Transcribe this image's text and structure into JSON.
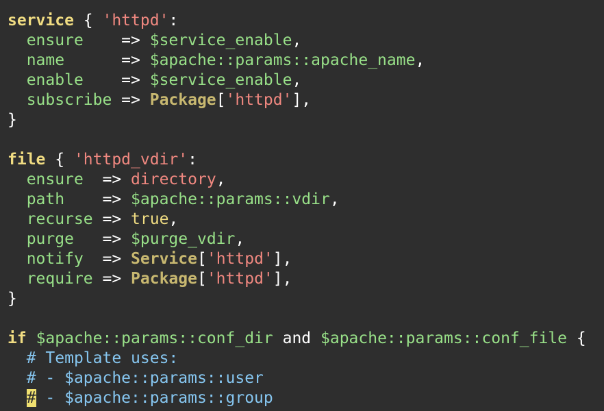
{
  "editor": {
    "lines": [
      [
        {
          "t": "service",
          "c": "kw"
        },
        {
          "t": " { ",
          "c": "op"
        },
        {
          "t": "'httpd'",
          "c": "str"
        },
        {
          "t": ":",
          "c": "op"
        }
      ],
      [
        {
          "t": "  ",
          "c": "op"
        },
        {
          "t": "ensure",
          "c": "attr"
        },
        {
          "t": "    => ",
          "c": "op"
        },
        {
          "t": "$service_enable",
          "c": "var"
        },
        {
          "t": ",",
          "c": "op"
        }
      ],
      [
        {
          "t": "  ",
          "c": "op"
        },
        {
          "t": "name",
          "c": "attr"
        },
        {
          "t": "      => ",
          "c": "op"
        },
        {
          "t": "$apache::params::apache_name",
          "c": "var"
        },
        {
          "t": ",",
          "c": "op"
        }
      ],
      [
        {
          "t": "  ",
          "c": "op"
        },
        {
          "t": "enable",
          "c": "attr"
        },
        {
          "t": "    => ",
          "c": "op"
        },
        {
          "t": "$service_enable",
          "c": "var"
        },
        {
          "t": ",",
          "c": "op"
        }
      ],
      [
        {
          "t": "  ",
          "c": "op"
        },
        {
          "t": "subscribe",
          "c": "attr"
        },
        {
          "t": " => ",
          "c": "op"
        },
        {
          "t": "Package",
          "c": "type"
        },
        {
          "t": "[",
          "c": "op"
        },
        {
          "t": "'httpd'",
          "c": "str"
        },
        {
          "t": "],",
          "c": "op"
        }
      ],
      [
        {
          "t": "}",
          "c": "op"
        }
      ],
      [],
      [
        {
          "t": "file",
          "c": "kw"
        },
        {
          "t": " { ",
          "c": "op"
        },
        {
          "t": "'httpd_vdir'",
          "c": "str"
        },
        {
          "t": ":",
          "c": "op"
        }
      ],
      [
        {
          "t": "  ",
          "c": "op"
        },
        {
          "t": "ensure",
          "c": "attr"
        },
        {
          "t": "  => ",
          "c": "op"
        },
        {
          "t": "directory",
          "c": "const"
        },
        {
          "t": ",",
          "c": "op"
        }
      ],
      [
        {
          "t": "  ",
          "c": "op"
        },
        {
          "t": "path",
          "c": "attr"
        },
        {
          "t": "    => ",
          "c": "op"
        },
        {
          "t": "$apache::params::vdir",
          "c": "var"
        },
        {
          "t": ",",
          "c": "op"
        }
      ],
      [
        {
          "t": "  ",
          "c": "op"
        },
        {
          "t": "recurse",
          "c": "attr"
        },
        {
          "t": " => ",
          "c": "op"
        },
        {
          "t": "true",
          "c": "bool"
        },
        {
          "t": ",",
          "c": "op"
        }
      ],
      [
        {
          "t": "  ",
          "c": "op"
        },
        {
          "t": "purge",
          "c": "attr"
        },
        {
          "t": "   => ",
          "c": "op"
        },
        {
          "t": "$purge_vdir",
          "c": "var"
        },
        {
          "t": ",",
          "c": "op"
        }
      ],
      [
        {
          "t": "  ",
          "c": "op"
        },
        {
          "t": "notify",
          "c": "attr"
        },
        {
          "t": "  => ",
          "c": "op"
        },
        {
          "t": "Service",
          "c": "type"
        },
        {
          "t": "[",
          "c": "op"
        },
        {
          "t": "'httpd'",
          "c": "str"
        },
        {
          "t": "],",
          "c": "op"
        }
      ],
      [
        {
          "t": "  ",
          "c": "op"
        },
        {
          "t": "require",
          "c": "attr"
        },
        {
          "t": " => ",
          "c": "op"
        },
        {
          "t": "Package",
          "c": "type"
        },
        {
          "t": "[",
          "c": "op"
        },
        {
          "t": "'httpd'",
          "c": "str"
        },
        {
          "t": "],",
          "c": "op"
        }
      ],
      [
        {
          "t": "}",
          "c": "op"
        }
      ],
      [],
      [
        {
          "t": "if",
          "c": "kw"
        },
        {
          "t": " ",
          "c": "op"
        },
        {
          "t": "$apache::params::conf_dir",
          "c": "var"
        },
        {
          "t": " and ",
          "c": "op"
        },
        {
          "t": "$apache::params::conf_file",
          "c": "var"
        },
        {
          "t": " {",
          "c": "op"
        }
      ],
      [
        {
          "t": "  ",
          "c": "op"
        },
        {
          "t": "# Template uses:",
          "c": "cmt"
        }
      ],
      [
        {
          "t": "  ",
          "c": "op"
        },
        {
          "t": "# - $apache::params::user",
          "c": "cmt"
        }
      ],
      [
        {
          "t": "  ",
          "c": "op"
        },
        {
          "t": "#",
          "c": "cmt cursor"
        },
        {
          "t": " - $apache::params::group",
          "c": "cmt"
        }
      ]
    ]
  },
  "colors": {
    "background": "#2e2e2e",
    "keyword": "#f0dc82",
    "string": "#f08880",
    "variable": "#98e088",
    "type": "#c8b870",
    "comment": "#86c6f0",
    "cursor": "#f0e070"
  }
}
